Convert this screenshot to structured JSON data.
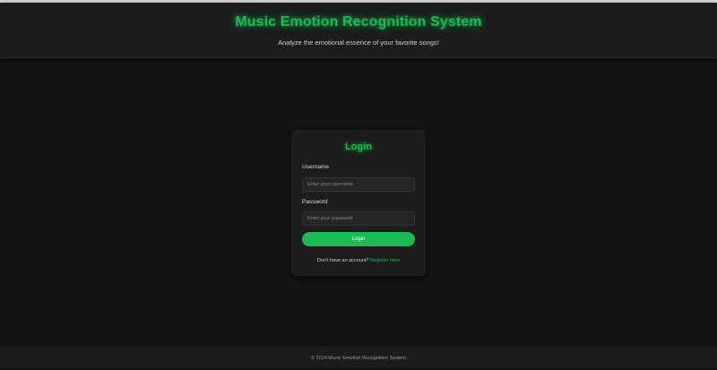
{
  "header": {
    "title": "Music Emotion Recognition System",
    "subtitle": "Analyze the emotional essence of your favorite songs!"
  },
  "login": {
    "title": "Login",
    "username_label": "Username",
    "username_placeholder": "Enter your username",
    "password_label": "Password",
    "password_placeholder": "Enter your password",
    "button_label": "Login",
    "register_prompt": "Don't have an account?",
    "register_link": "Register here"
  },
  "footer": {
    "text": "© 2024 Music Emotion Recognition System"
  },
  "colors": {
    "accent": "#1db954",
    "background": "#141414",
    "card": "#1d1d1d"
  }
}
